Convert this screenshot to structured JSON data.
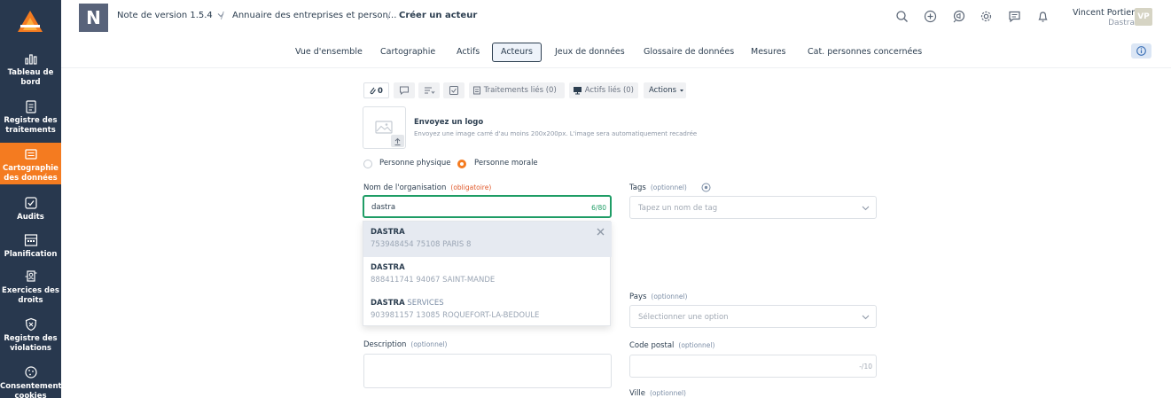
{
  "sidebar": {
    "items": [
      {
        "label": "Tableau de bord",
        "icon": "bar-chart-icon"
      },
      {
        "label": "Registre des traitements",
        "icon": "clipboard-icon"
      },
      {
        "label": "Cartographie des données",
        "icon": "map-icon"
      },
      {
        "label": "Audits",
        "icon": "checkbox-icon"
      },
      {
        "label": "Planification",
        "icon": "calendar-icon"
      },
      {
        "label": "Exercices des droits",
        "icon": "user-rights-icon"
      },
      {
        "label": "Registre des violations",
        "icon": "shield-icon"
      },
      {
        "label": "Consentement cookies",
        "icon": "cookie-icon"
      }
    ],
    "active_color": "#f47b20"
  },
  "header": {
    "org_initial": "N",
    "org_name": "Note de version 1.5.4",
    "breadcrumb": [
      "Annuaire des entreprises et person...",
      "Créer un acteur"
    ],
    "sep": "/",
    "user_name": "Vincent Portier",
    "user_org": "Dastra",
    "user_initials": "VP"
  },
  "tabs": [
    {
      "label": "Vue d'ensemble"
    },
    {
      "label": "Cartographie"
    },
    {
      "label": "Actifs"
    },
    {
      "label": "Acteurs",
      "active": true
    },
    {
      "label": "Jeux de données"
    },
    {
      "label": "Glossaire de données"
    },
    {
      "label": "Mesures"
    },
    {
      "label": "Cat. personnes concernées"
    }
  ],
  "toolbar": {
    "attachments_count": "0",
    "treatments_label": "Traitements liés (0)",
    "assets_label": "Actifs liés (0)",
    "actions_label": "Actions"
  },
  "logo_upload": {
    "title": "Envoyez un logo",
    "desc": "Envoyez une image carré d'au moins 200x200px. L'image sera automatiquement recadrée"
  },
  "person_type": {
    "physical": "Personne physique",
    "moral": "Personne morale",
    "selected": "moral"
  },
  "form": {
    "org_name_label": "Nom de l'organisation",
    "required": "(obligatoire)",
    "optional": "(optionnel)",
    "org_name_value": "dastra",
    "org_name_counter": "6/80",
    "tags_label": "Tags",
    "tags_placeholder": "Tapez un nom de tag",
    "country_label": "Pays",
    "country_placeholder": "Sélectionner une option",
    "description_label": "Description",
    "postal_label": "Code postal",
    "postal_counter": "-/10",
    "city_label": "Ville"
  },
  "suggestions": [
    {
      "name": "DASTRA",
      "rest": "",
      "addr": "753948454 75108 PARIS 8"
    },
    {
      "name": "DASTRA",
      "rest": "",
      "addr": "888411741 94067 SAINT-MANDE"
    },
    {
      "name": "DASTRA",
      "rest": " SERVICES",
      "addr": "903981157 13085 ROQUEFORT-LA-BEDOULE"
    }
  ],
  "colors": {
    "sidebar_bg": "#28384e",
    "accent": "#f47b20",
    "focus": "#1f9d66",
    "required": "#e05a2c"
  }
}
